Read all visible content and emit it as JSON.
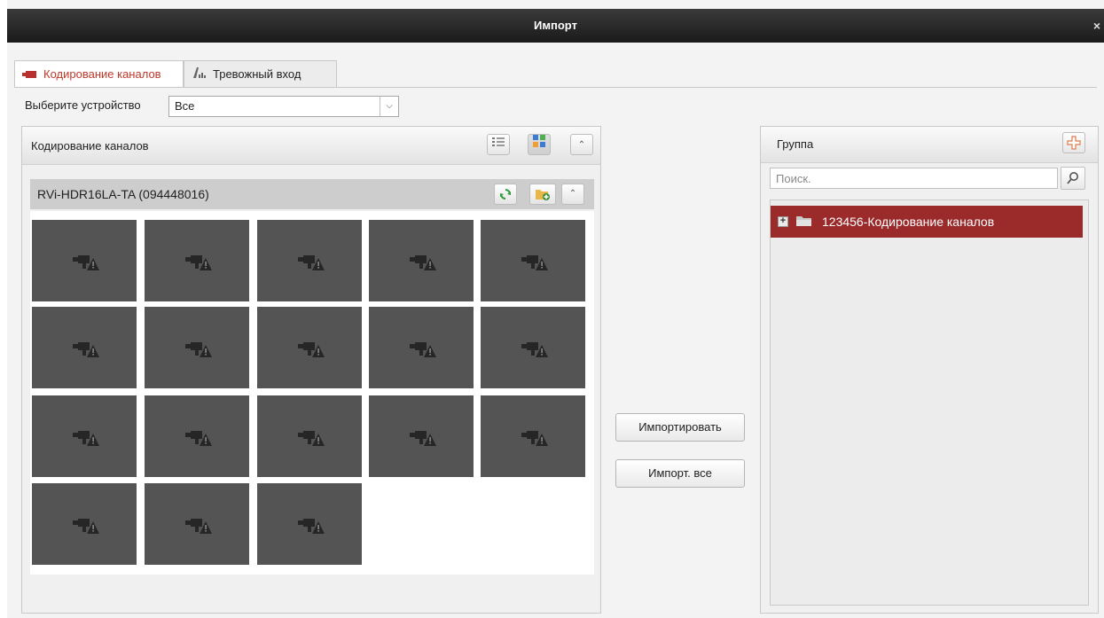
{
  "window": {
    "title": "Импорт",
    "close_glyph": "×"
  },
  "tabs": [
    {
      "label": "Кодирование каналов",
      "icon": "camera-icon",
      "active": true
    },
    {
      "label": "Тревожный вход",
      "icon": "alarm-input-icon",
      "active": false
    }
  ],
  "device_select": {
    "label": "Выберите устройство",
    "value": "Все"
  },
  "channels_panel": {
    "title": "Кодирование каналов",
    "device": {
      "name": "RVi-HDR16LA-TA (094448016)"
    },
    "channel_count": 18
  },
  "actions": {
    "import_label": "Импортировать",
    "import_all_label": "Импорт. все"
  },
  "group_panel": {
    "title": "Группа",
    "search_placeholder": "Поиск.",
    "tree": [
      {
        "label": "123456-Кодирование каналов",
        "selected": true
      }
    ]
  },
  "colors": {
    "active_tab_text": "#c0392b",
    "selected_row": "#9b2a2a",
    "channel_tile": "#545454"
  }
}
